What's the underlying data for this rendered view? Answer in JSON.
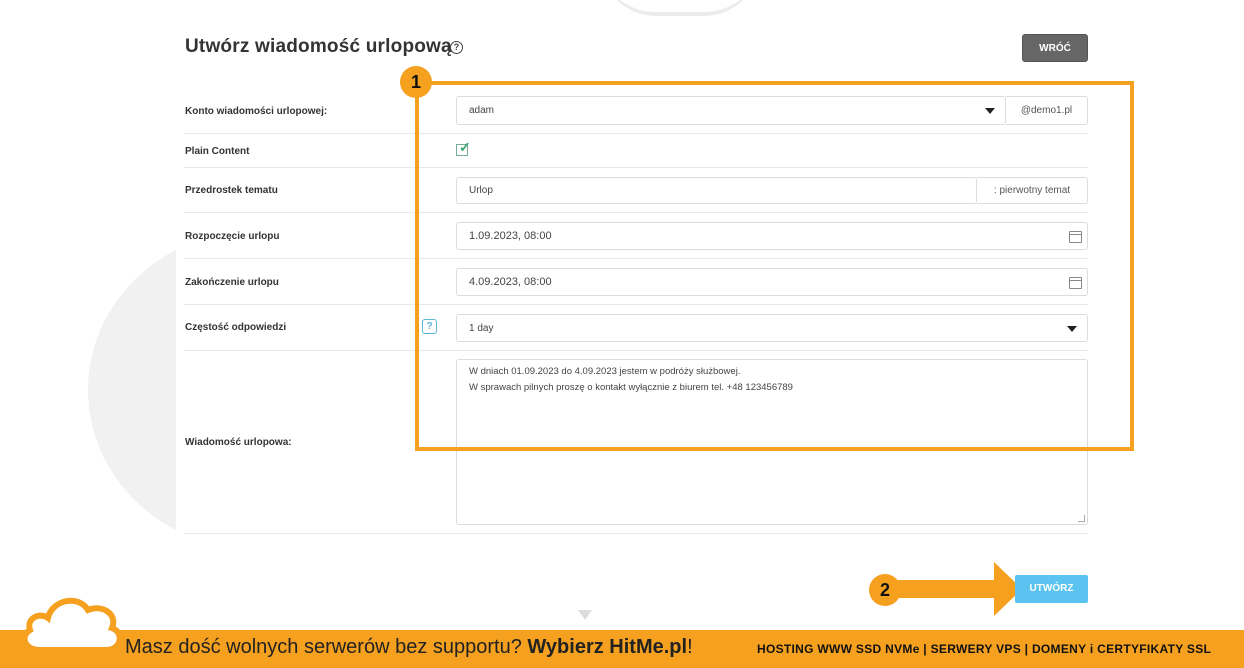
{
  "page": {
    "title": "Utwórz wiadomość urlopową",
    "back_label": "WRÓĆ",
    "create_label": "UTWÓRZ"
  },
  "form": {
    "account": {
      "label": "Konto wiadomości urlopowej:",
      "value": "adam",
      "domain": "@demo1.pl"
    },
    "plain_content": {
      "label": "Plain Content",
      "checked": true
    },
    "subject_prefix": {
      "label": "Przedrostek tematu",
      "value": "Urlop",
      "suffix": ": pierwotny temat"
    },
    "start": {
      "label": "Rozpoczęcie urlopu",
      "value": "1.09.2023, 08:00"
    },
    "end": {
      "label": "Zakończenie urlopu",
      "value": "4.09.2023, 08:00"
    },
    "frequency": {
      "label": "Częstość odpowiedzi",
      "value": "1 day"
    },
    "message": {
      "label": "Wiadomość urlopowa:",
      "line1": "W dniach 01.09.2023 do 4.09.2023 jestem w podróży służbowej.",
      "line2": "W sprawach pilnych proszę o kontakt wyłącznie z biurem tel. +48 123456789"
    }
  },
  "annotations": {
    "badge1": "1",
    "badge2": "2",
    "color": "#f5a01e"
  },
  "banner": {
    "text_prefix": "Masz dość wolnych serwerów bez supportu? ",
    "text_bold": "Wybierz HitMe.pl",
    "text_suffix": "!",
    "right": "HOSTING WWW SSD NVMe | SERWERY VPS | DOMENY i CERTYFIKATY SSL"
  }
}
